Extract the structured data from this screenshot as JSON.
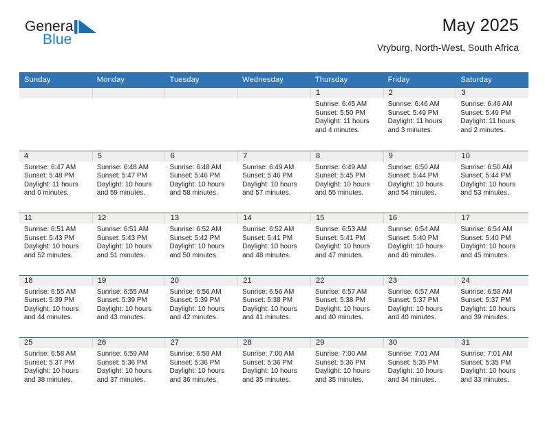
{
  "brand": {
    "name_part1": "General",
    "name_part2": "Blue",
    "mark_icon": "blue-triangle-flag-icon",
    "accent_color": "#1a7fd4",
    "text_color": "#231f20"
  },
  "header": {
    "title": "May 2025",
    "subtitle": "Vryburg, North-West, South Africa"
  },
  "theme": {
    "header_blue": "#3174b4",
    "day_band_gray": "#efefef",
    "text_dark": "#1a1a1a"
  },
  "weekdays": [
    "Sunday",
    "Monday",
    "Tuesday",
    "Wednesday",
    "Thursday",
    "Friday",
    "Saturday"
  ],
  "weeks": [
    [
      {
        "day": "",
        "empty": true
      },
      {
        "day": "",
        "empty": true
      },
      {
        "day": "",
        "empty": true
      },
      {
        "day": "",
        "empty": true
      },
      {
        "day": "1",
        "sunrise": "Sunrise: 6:45 AM",
        "sunset": "Sunset: 5:50 PM",
        "daylight_line1": "Daylight: 11 hours",
        "daylight_line2": "and 4 minutes."
      },
      {
        "day": "2",
        "sunrise": "Sunrise: 6:46 AM",
        "sunset": "Sunset: 5:49 PM",
        "daylight_line1": "Daylight: 11 hours",
        "daylight_line2": "and 3 minutes."
      },
      {
        "day": "3",
        "sunrise": "Sunrise: 6:46 AM",
        "sunset": "Sunset: 5:49 PM",
        "daylight_line1": "Daylight: 11 hours",
        "daylight_line2": "and 2 minutes."
      }
    ],
    [
      {
        "day": "4",
        "sunrise": "Sunrise: 6:47 AM",
        "sunset": "Sunset: 5:48 PM",
        "daylight_line1": "Daylight: 11 hours",
        "daylight_line2": "and 0 minutes."
      },
      {
        "day": "5",
        "sunrise": "Sunrise: 6:48 AM",
        "sunset": "Sunset: 5:47 PM",
        "daylight_line1": "Daylight: 10 hours",
        "daylight_line2": "and 59 minutes."
      },
      {
        "day": "6",
        "sunrise": "Sunrise: 6:48 AM",
        "sunset": "Sunset: 5:46 PM",
        "daylight_line1": "Daylight: 10 hours",
        "daylight_line2": "and 58 minutes."
      },
      {
        "day": "7",
        "sunrise": "Sunrise: 6:49 AM",
        "sunset": "Sunset: 5:46 PM",
        "daylight_line1": "Daylight: 10 hours",
        "daylight_line2": "and 57 minutes."
      },
      {
        "day": "8",
        "sunrise": "Sunrise: 6:49 AM",
        "sunset": "Sunset: 5:45 PM",
        "daylight_line1": "Daylight: 10 hours",
        "daylight_line2": "and 55 minutes."
      },
      {
        "day": "9",
        "sunrise": "Sunrise: 6:50 AM",
        "sunset": "Sunset: 5:44 PM",
        "daylight_line1": "Daylight: 10 hours",
        "daylight_line2": "and 54 minutes."
      },
      {
        "day": "10",
        "sunrise": "Sunrise: 6:50 AM",
        "sunset": "Sunset: 5:44 PM",
        "daylight_line1": "Daylight: 10 hours",
        "daylight_line2": "and 53 minutes."
      }
    ],
    [
      {
        "day": "11",
        "sunrise": "Sunrise: 6:51 AM",
        "sunset": "Sunset: 5:43 PM",
        "daylight_line1": "Daylight: 10 hours",
        "daylight_line2": "and 52 minutes."
      },
      {
        "day": "12",
        "sunrise": "Sunrise: 6:51 AM",
        "sunset": "Sunset: 5:43 PM",
        "daylight_line1": "Daylight: 10 hours",
        "daylight_line2": "and 51 minutes."
      },
      {
        "day": "13",
        "sunrise": "Sunrise: 6:52 AM",
        "sunset": "Sunset: 5:42 PM",
        "daylight_line1": "Daylight: 10 hours",
        "daylight_line2": "and 50 minutes."
      },
      {
        "day": "14",
        "sunrise": "Sunrise: 6:52 AM",
        "sunset": "Sunset: 5:41 PM",
        "daylight_line1": "Daylight: 10 hours",
        "daylight_line2": "and 48 minutes."
      },
      {
        "day": "15",
        "sunrise": "Sunrise: 6:53 AM",
        "sunset": "Sunset: 5:41 PM",
        "daylight_line1": "Daylight: 10 hours",
        "daylight_line2": "and 47 minutes."
      },
      {
        "day": "16",
        "sunrise": "Sunrise: 6:54 AM",
        "sunset": "Sunset: 5:40 PM",
        "daylight_line1": "Daylight: 10 hours",
        "daylight_line2": "and 46 minutes."
      },
      {
        "day": "17",
        "sunrise": "Sunrise: 6:54 AM",
        "sunset": "Sunset: 5:40 PM",
        "daylight_line1": "Daylight: 10 hours",
        "daylight_line2": "and 45 minutes."
      }
    ],
    [
      {
        "day": "18",
        "sunrise": "Sunrise: 6:55 AM",
        "sunset": "Sunset: 5:39 PM",
        "daylight_line1": "Daylight: 10 hours",
        "daylight_line2": "and 44 minutes."
      },
      {
        "day": "19",
        "sunrise": "Sunrise: 6:55 AM",
        "sunset": "Sunset: 5:39 PM",
        "daylight_line1": "Daylight: 10 hours",
        "daylight_line2": "and 43 minutes."
      },
      {
        "day": "20",
        "sunrise": "Sunrise: 6:56 AM",
        "sunset": "Sunset: 5:39 PM",
        "daylight_line1": "Daylight: 10 hours",
        "daylight_line2": "and 42 minutes."
      },
      {
        "day": "21",
        "sunrise": "Sunrise: 6:56 AM",
        "sunset": "Sunset: 5:38 PM",
        "daylight_line1": "Daylight: 10 hours",
        "daylight_line2": "and 41 minutes."
      },
      {
        "day": "22",
        "sunrise": "Sunrise: 6:57 AM",
        "sunset": "Sunset: 5:38 PM",
        "daylight_line1": "Daylight: 10 hours",
        "daylight_line2": "and 40 minutes."
      },
      {
        "day": "23",
        "sunrise": "Sunrise: 6:57 AM",
        "sunset": "Sunset: 5:37 PM",
        "daylight_line1": "Daylight: 10 hours",
        "daylight_line2": "and 40 minutes."
      },
      {
        "day": "24",
        "sunrise": "Sunrise: 6:58 AM",
        "sunset": "Sunset: 5:37 PM",
        "daylight_line1": "Daylight: 10 hours",
        "daylight_line2": "and 39 minutes."
      }
    ],
    [
      {
        "day": "25",
        "sunrise": "Sunrise: 6:58 AM",
        "sunset": "Sunset: 5:37 PM",
        "daylight_line1": "Daylight: 10 hours",
        "daylight_line2": "and 38 minutes."
      },
      {
        "day": "26",
        "sunrise": "Sunrise: 6:59 AM",
        "sunset": "Sunset: 5:36 PM",
        "daylight_line1": "Daylight: 10 hours",
        "daylight_line2": "and 37 minutes."
      },
      {
        "day": "27",
        "sunrise": "Sunrise: 6:59 AM",
        "sunset": "Sunset: 5:36 PM",
        "daylight_line1": "Daylight: 10 hours",
        "daylight_line2": "and 36 minutes."
      },
      {
        "day": "28",
        "sunrise": "Sunrise: 7:00 AM",
        "sunset": "Sunset: 5:36 PM",
        "daylight_line1": "Daylight: 10 hours",
        "daylight_line2": "and 35 minutes."
      },
      {
        "day": "29",
        "sunrise": "Sunrise: 7:00 AM",
        "sunset": "Sunset: 5:36 PM",
        "daylight_line1": "Daylight: 10 hours",
        "daylight_line2": "and 35 minutes."
      },
      {
        "day": "30",
        "sunrise": "Sunrise: 7:01 AM",
        "sunset": "Sunset: 5:35 PM",
        "daylight_line1": "Daylight: 10 hours",
        "daylight_line2": "and 34 minutes."
      },
      {
        "day": "31",
        "sunrise": "Sunrise: 7:01 AM",
        "sunset": "Sunset: 5:35 PM",
        "daylight_line1": "Daylight: 10 hours",
        "daylight_line2": "and 33 minutes."
      }
    ]
  ]
}
